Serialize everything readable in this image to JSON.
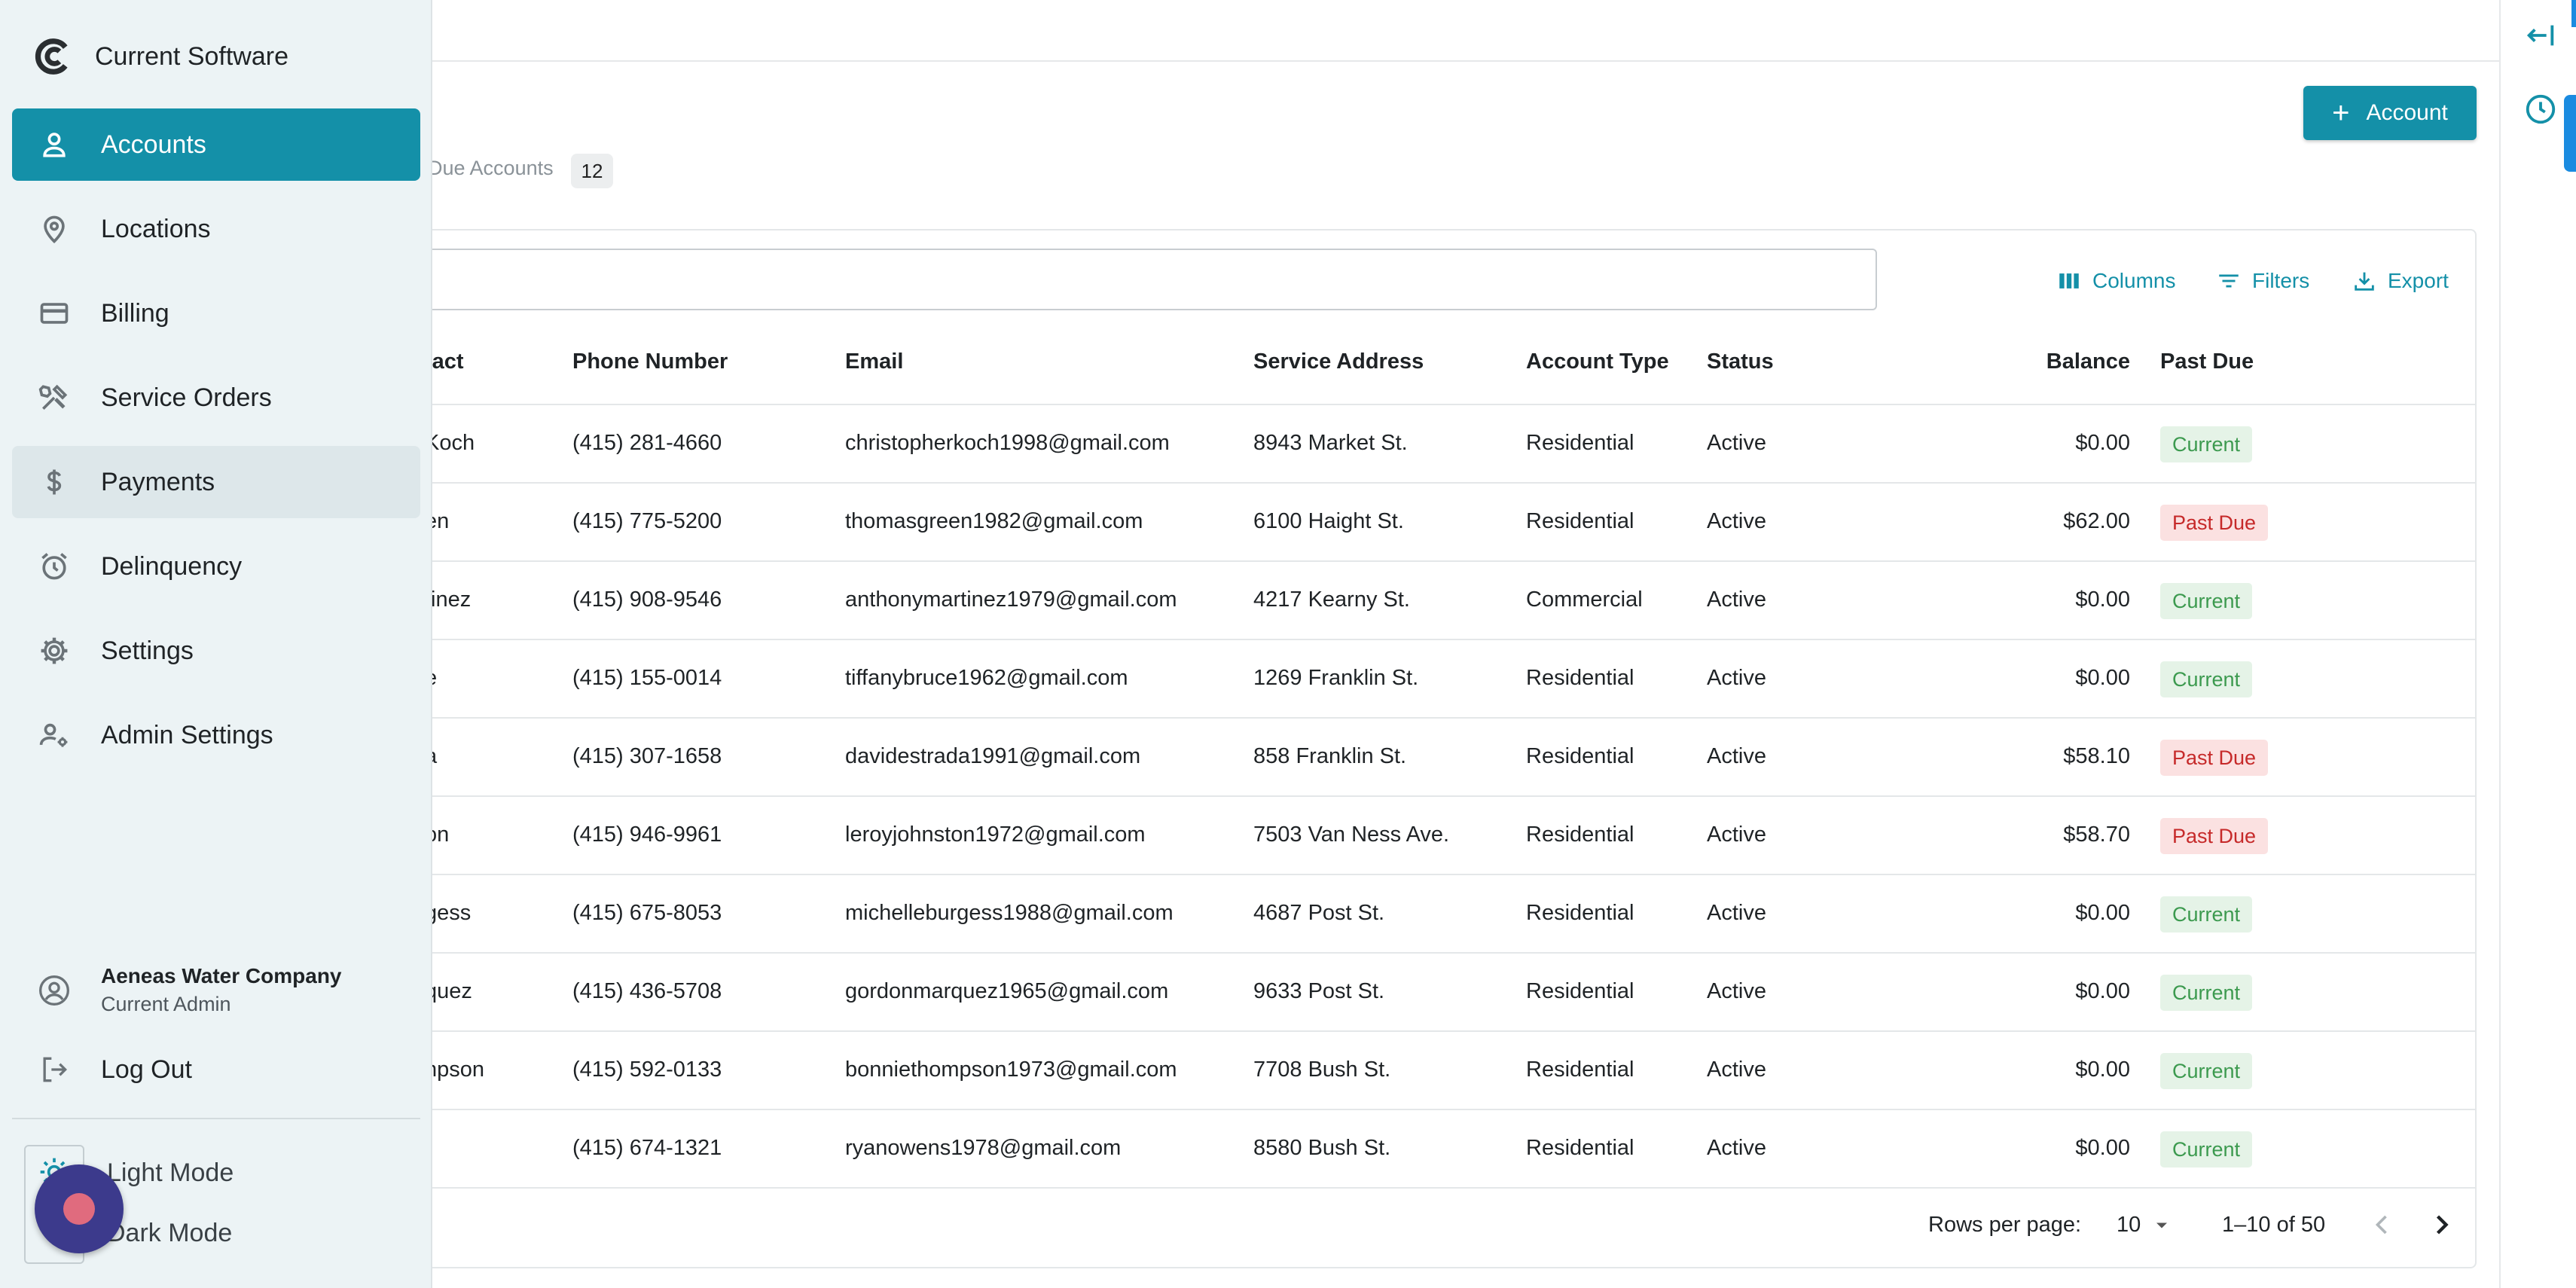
{
  "brand": {
    "name": "Current Software"
  },
  "nav": {
    "items": [
      {
        "label": "Accounts",
        "icon": "person-icon",
        "state": "active"
      },
      {
        "label": "Locations",
        "icon": "location-pin-icon",
        "state": ""
      },
      {
        "label": "Billing",
        "icon": "credit-card-icon",
        "state": ""
      },
      {
        "label": "Service Orders",
        "icon": "tools-icon",
        "state": ""
      },
      {
        "label": "Payments",
        "icon": "dollar-icon",
        "state": "hover"
      },
      {
        "label": "Delinquency",
        "icon": "alarm-icon",
        "state": ""
      },
      {
        "label": "Settings",
        "icon": "gear-icon",
        "state": ""
      },
      {
        "label": "Admin Settings",
        "icon": "people-gear-icon",
        "state": ""
      }
    ]
  },
  "account": {
    "company": "Aeneas Water Company",
    "role": "Current Admin"
  },
  "logout_label": "Log Out",
  "modes": {
    "light": "Light Mode",
    "dark": "Dark Mode"
  },
  "header": {
    "add_button": "Account"
  },
  "tab": {
    "label": "Due Accounts",
    "count": "12"
  },
  "toolbar": {
    "columns": "Columns",
    "filters": "Filters",
    "export": "Export"
  },
  "table": {
    "columns": {
      "contact": "tact",
      "phone": "Phone Number",
      "email": "Email",
      "address": "Service Address",
      "type": "Account Type",
      "status": "Status",
      "balance": "Balance",
      "pastdue": "Past Due"
    },
    "rows": [
      {
        "contact": "Koch",
        "phone": "(415) 281-4660",
        "email": "christopherkoch1998@gmail.com",
        "address": "8943 Market St.",
        "type": "Residential",
        "status": "Active",
        "balance": "$0.00",
        "pastdue": "Current",
        "pastdue_kind": "current"
      },
      {
        "contact": "en",
        "phone": "(415) 775-5200",
        "email": "thomasgreen1982@gmail.com",
        "address": "6100 Haight St.",
        "type": "Residential",
        "status": "Active",
        "balance": "$62.00",
        "pastdue": "Past Due",
        "pastdue_kind": "pastdue"
      },
      {
        "contact": "tinez",
        "phone": "(415) 908-9546",
        "email": "anthonymartinez1979@gmail.com",
        "address": "4217 Kearny St.",
        "type": "Commercial",
        "status": "Active",
        "balance": "$0.00",
        "pastdue": "Current",
        "pastdue_kind": "current"
      },
      {
        "contact": "e",
        "phone": "(415) 155-0014",
        "email": "tiffanybruce1962@gmail.com",
        "address": "1269 Franklin St.",
        "type": "Residential",
        "status": "Active",
        "balance": "$0.00",
        "pastdue": "Current",
        "pastdue_kind": "current"
      },
      {
        "contact": "a",
        "phone": "(415) 307-1658",
        "email": "davidestrada1991@gmail.com",
        "address": "858 Franklin St.",
        "type": "Residential",
        "status": "Active",
        "balance": "$58.10",
        "pastdue": "Past Due",
        "pastdue_kind": "pastdue"
      },
      {
        "contact": "on",
        "phone": "(415) 946-9961",
        "email": "leroyjohnston1972@gmail.com",
        "address": "7503 Van Ness Ave.",
        "type": "Residential",
        "status": "Active",
        "balance": "$58.70",
        "pastdue": "Past Due",
        "pastdue_kind": "pastdue"
      },
      {
        "contact": "gess",
        "phone": "(415) 675-8053",
        "email": "michelleburgess1988@gmail.com",
        "address": "4687 Post St.",
        "type": "Residential",
        "status": "Active",
        "balance": "$0.00",
        "pastdue": "Current",
        "pastdue_kind": "current"
      },
      {
        "contact": "quez",
        "phone": "(415) 436-5708",
        "email": "gordonmarquez1965@gmail.com",
        "address": "9633 Post St.",
        "type": "Residential",
        "status": "Active",
        "balance": "$0.00",
        "pastdue": "Current",
        "pastdue_kind": "current"
      },
      {
        "contact": "npson",
        "phone": "(415) 592-0133",
        "email": "bonniethompson1973@gmail.com",
        "address": "7708 Bush St.",
        "type": "Residential",
        "status": "Active",
        "balance": "$0.00",
        "pastdue": "Current",
        "pastdue_kind": "current"
      },
      {
        "contact": "",
        "phone": "(415) 674-1321",
        "email": "ryanowens1978@gmail.com",
        "address": "8580 Bush St.",
        "type": "Residential",
        "status": "Active",
        "balance": "$0.00",
        "pastdue": "Current",
        "pastdue_kind": "current"
      }
    ]
  },
  "pagination": {
    "rows_label": "Rows per page:",
    "rows_value": "10",
    "range": "1–10 of 50"
  },
  "colors": {
    "accent": "#1490a8",
    "current_bg": "#e5f3e7",
    "pastdue_bg": "#fbe1e1",
    "drawer_bg": "#ecf3f5"
  }
}
